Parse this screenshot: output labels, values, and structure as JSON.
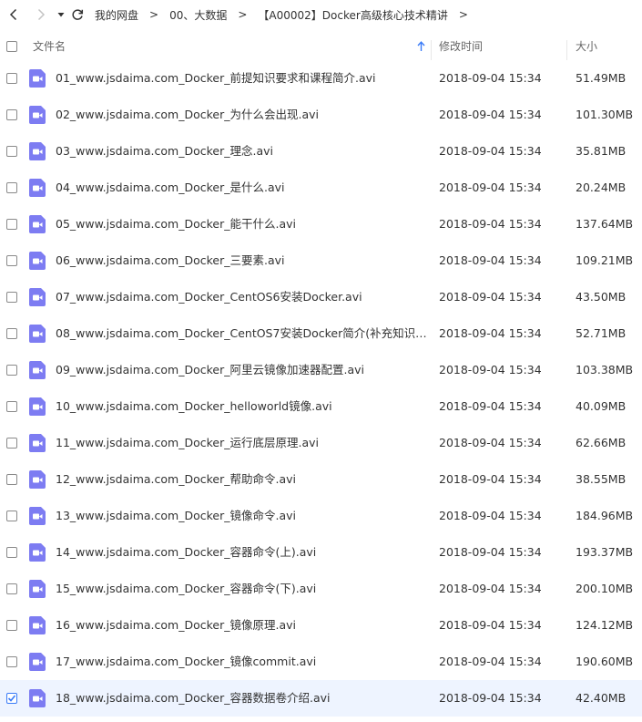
{
  "breadcrumb": {
    "items": [
      "我的网盘",
      "00、大数据",
      "【A00002】Docker高级核心技术精讲"
    ],
    "separator": ">"
  },
  "columns": {
    "name": "文件名",
    "modified": "修改时间",
    "size": "大小"
  },
  "colors": {
    "accent": "#3a7bf7",
    "video_icon": "#7d7cf2",
    "selected_row": "#eef4ff"
  },
  "files": [
    {
      "name": "01_www.jsdaima.com_Docker_前提知识要求和课程简介.avi",
      "modified": "2018-09-04 15:34",
      "size": "51.49MB",
      "selected": false
    },
    {
      "name": "02_www.jsdaima.com_Docker_为什么会出现.avi",
      "modified": "2018-09-04 15:34",
      "size": "101.30MB",
      "selected": false
    },
    {
      "name": "03_www.jsdaima.com_Docker_理念.avi",
      "modified": "2018-09-04 15:34",
      "size": "35.81MB",
      "selected": false
    },
    {
      "name": "04_www.jsdaima.com_Docker_是什么.avi",
      "modified": "2018-09-04 15:34",
      "size": "20.24MB",
      "selected": false
    },
    {
      "name": "05_www.jsdaima.com_Docker_能干什么.avi",
      "modified": "2018-09-04 15:34",
      "size": "137.64MB",
      "selected": false
    },
    {
      "name": "06_www.jsdaima.com_Docker_三要素.avi",
      "modified": "2018-09-04 15:34",
      "size": "109.21MB",
      "selected": false
    },
    {
      "name": "07_www.jsdaima.com_Docker_CentOS6安装Docker.avi",
      "modified": "2018-09-04 15:34",
      "size": "43.50MB",
      "selected": false
    },
    {
      "name": "08_www.jsdaima.com_Docker_CentOS7安装Docker简介(补充知识请看...",
      "modified": "2018-09-04 15:34",
      "size": "52.71MB",
      "selected": false
    },
    {
      "name": "09_www.jsdaima.com_Docker_阿里云镜像加速器配置.avi",
      "modified": "2018-09-04 15:34",
      "size": "103.38MB",
      "selected": false
    },
    {
      "name": "10_www.jsdaima.com_Docker_helloworld镜像.avi",
      "modified": "2018-09-04 15:34",
      "size": "40.09MB",
      "selected": false
    },
    {
      "name": "11_www.jsdaima.com_Docker_运行底层原理.avi",
      "modified": "2018-09-04 15:34",
      "size": "62.66MB",
      "selected": false
    },
    {
      "name": "12_www.jsdaima.com_Docker_帮助命令.avi",
      "modified": "2018-09-04 15:34",
      "size": "38.55MB",
      "selected": false
    },
    {
      "name": "13_www.jsdaima.com_Docker_镜像命令.avi",
      "modified": "2018-09-04 15:34",
      "size": "184.96MB",
      "selected": false
    },
    {
      "name": "14_www.jsdaima.com_Docker_容器命令(上).avi",
      "modified": "2018-09-04 15:34",
      "size": "193.37MB",
      "selected": false
    },
    {
      "name": "15_www.jsdaima.com_Docker_容器命令(下).avi",
      "modified": "2018-09-04 15:34",
      "size": "200.10MB",
      "selected": false
    },
    {
      "name": "16_www.jsdaima.com_Docker_镜像原理.avi",
      "modified": "2018-09-04 15:34",
      "size": "124.12MB",
      "selected": false
    },
    {
      "name": "17_www.jsdaima.com_Docker_镜像commit.avi",
      "modified": "2018-09-04 15:34",
      "size": "190.60MB",
      "selected": false
    },
    {
      "name": "18_www.jsdaima.com_Docker_容器数据卷介绍.avi",
      "modified": "2018-09-04 15:34",
      "size": "42.40MB",
      "selected": true
    }
  ]
}
